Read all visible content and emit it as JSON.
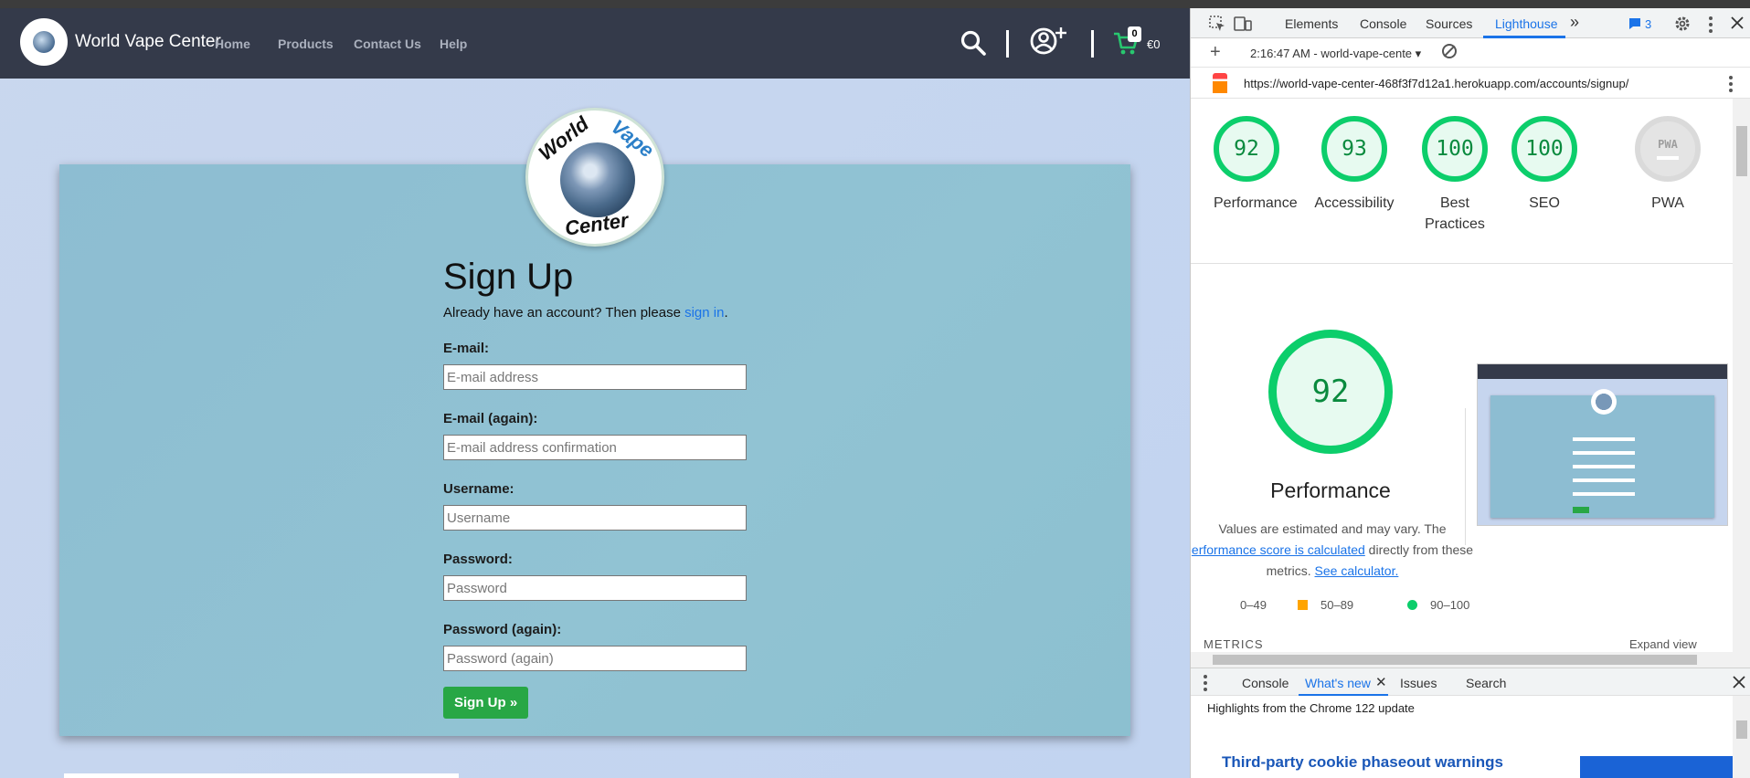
{
  "navbar": {
    "brand": "World Vape Center",
    "links": [
      "Home",
      "Products",
      "Contact Us",
      "Help"
    ],
    "cart_count": "0",
    "cart_total": "€0"
  },
  "logo": {
    "word1": "World",
    "word2": "Vape",
    "word3": "Center"
  },
  "signup": {
    "title": "Sign Up",
    "lead_text": "Already have an account? Then please ",
    "lead_link": "sign in",
    "lead_end": ".",
    "email_label": "E-mail:",
    "email_placeholder": "E-mail address",
    "email2_label": "E-mail (again):",
    "email2_placeholder": "E-mail address confirmation",
    "username_label": "Username:",
    "username_placeholder": "Username",
    "password_label": "Password:",
    "password_placeholder": "Password",
    "password2_label": "Password (again):",
    "password2_placeholder": "Password (again)",
    "submit_label": "Sign Up »"
  },
  "devtools": {
    "tabs": [
      "Elements",
      "Console",
      "Sources",
      "Lighthouse"
    ],
    "more": "»",
    "issues_count": "3",
    "session": "2:16:47 AM - world-vape-cent⁠e",
    "url": "https://world-vape-center-468f3f7d12a1.herokuapp.com/accounts/signup/",
    "scores": [
      {
        "value": "92",
        "label": "Performance"
      },
      {
        "value": "93",
        "label": "Accessibility"
      },
      {
        "value": "100",
        "label": "Best Practices"
      },
      {
        "value": "100",
        "label": "SEO"
      }
    ],
    "pwa": {
      "badge": "PWA",
      "label": "PWA"
    },
    "main_score": "92",
    "main_label": "Performance",
    "note_pre": "Values are estimated and may vary. The ",
    "note_link1": "erformance score is calculated",
    "note_mid": " directly from these metrics. ",
    "note_link2": "See calculator.",
    "legend": [
      "0–49",
      "50–89",
      "90–100"
    ],
    "metrics_heading": "METRICS",
    "expand_view": "Expand view",
    "drawer_tabs": [
      "Console",
      "What's new",
      "Issues",
      "Search"
    ],
    "highlights": "Highlights from the Chrome 122 update",
    "promo_title": "Third-party cookie phaseout warnings"
  },
  "colors": {
    "nav_bg": "#343a4a",
    "card_bg": "#8dbdd2",
    "signup_btn": "#28a745",
    "lh_green": "#0cce6b",
    "link_blue": "#1a73e8"
  }
}
